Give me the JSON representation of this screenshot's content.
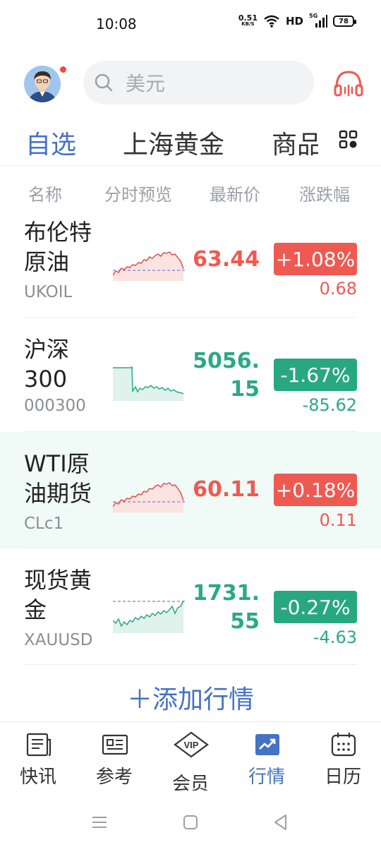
{
  "status_bar": {
    "time": "10:08",
    "net_speed_value": "0.51",
    "net_speed_unit": "KB/S",
    "hd": "HD",
    "signal_label": "5G",
    "battery": "78"
  },
  "header": {
    "search_placeholder": "美元"
  },
  "tabs": [
    {
      "label": "自选",
      "active": true
    },
    {
      "label": "上海黄金",
      "active": false
    },
    {
      "label": "商品",
      "active": false
    }
  ],
  "columns": {
    "name": "名称",
    "trend": "分时预览",
    "price": "最新价",
    "change": "涨跌幅"
  },
  "rows": [
    {
      "name_line1": "布伦特",
      "name_line2": "原油",
      "code": "UKOIL",
      "price_line1": "63.44",
      "price_line2": "",
      "change_pct": "+1.08%",
      "change_abs": "0.68",
      "direction": "up",
      "highlighted": false
    },
    {
      "name_line1": "沪深",
      "name_line2": "300",
      "code": "000300",
      "price_line1": "5056.",
      "price_line2": "15",
      "change_pct": "-1.67%",
      "change_abs": "-85.62",
      "direction": "down",
      "highlighted": false
    },
    {
      "name_line1": "WTI原",
      "name_line2": "油期货",
      "code": "CLc1",
      "price_line1": "60.11",
      "price_line2": "",
      "change_pct": "+0.18%",
      "change_abs": "0.11",
      "direction": "up",
      "highlighted": true
    },
    {
      "name_line1": "现货黄",
      "name_line2": "金",
      "code": "XAUUSD",
      "price_line1": "1731.",
      "price_line2": "55",
      "change_pct": "-0.27%",
      "change_abs": "-4.63",
      "direction": "down",
      "highlighted": false
    }
  ],
  "add_button": "＋添加行情",
  "bottom_nav": [
    {
      "label": "快讯",
      "icon": "news-icon",
      "active": false
    },
    {
      "label": "参考",
      "icon": "reference-icon",
      "active": false
    },
    {
      "label": "会员",
      "icon": "vip-icon",
      "active": false
    },
    {
      "label": "行情",
      "icon": "market-icon",
      "active": true
    },
    {
      "label": "日历",
      "icon": "calendar-icon",
      "active": false
    }
  ],
  "colors": {
    "accent": "#4472c4",
    "up": "#ee5a52",
    "down": "#27a880"
  }
}
